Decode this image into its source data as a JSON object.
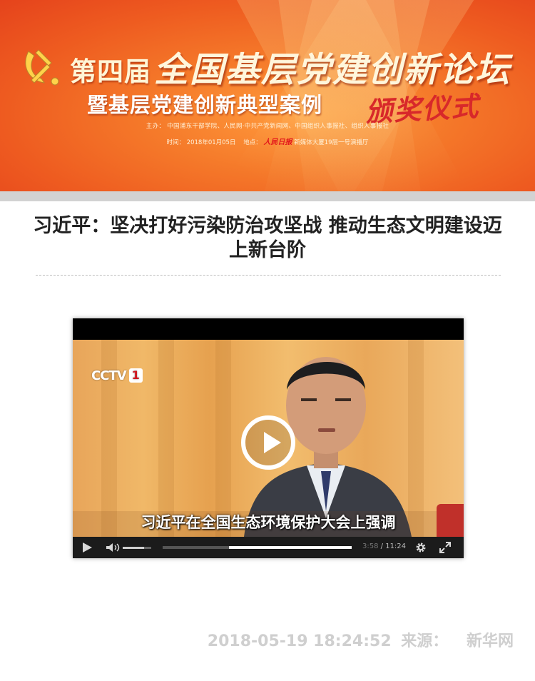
{
  "banner": {
    "title_prefix": "第四届",
    "title_main": "全国基层党建创新论坛",
    "title_line2": "暨基层党建创新典型案例",
    "title_line2_script": "颁奖仪式",
    "hosts": "主办：  中国浦东干部学院、人民网·中共产党新闻网、中国组织人事报社、组织人事报社",
    "time_label": "时间：",
    "time_value": "2018年01月05日",
    "place_label": "地点：",
    "place_brand": "人民日报",
    "place_value": "新媒体大厦19层一号演播厅",
    "colors": {
      "top": "#ee5b20",
      "center": "#ff9a3c",
      "script_red": "#d8282a"
    }
  },
  "article": {
    "headline": "习近平：坚决打好污染防治攻坚战 推动生态文明建设迈上新台阶"
  },
  "video": {
    "channel_logo_text": "CCTV",
    "channel_number": "1",
    "subtitle": "习近平在全国生态环境保护大会上强调",
    "play_icon": "play-circle-icon",
    "current_time": "3:58",
    "time_separator": " / ",
    "duration": "11:24",
    "progress_fraction": 0.35,
    "volume_fraction": 0.75
  },
  "meta": {
    "datetime": "2018-05-19 18:24:52",
    "source_label": "来源：",
    "source_name": "新华网"
  }
}
